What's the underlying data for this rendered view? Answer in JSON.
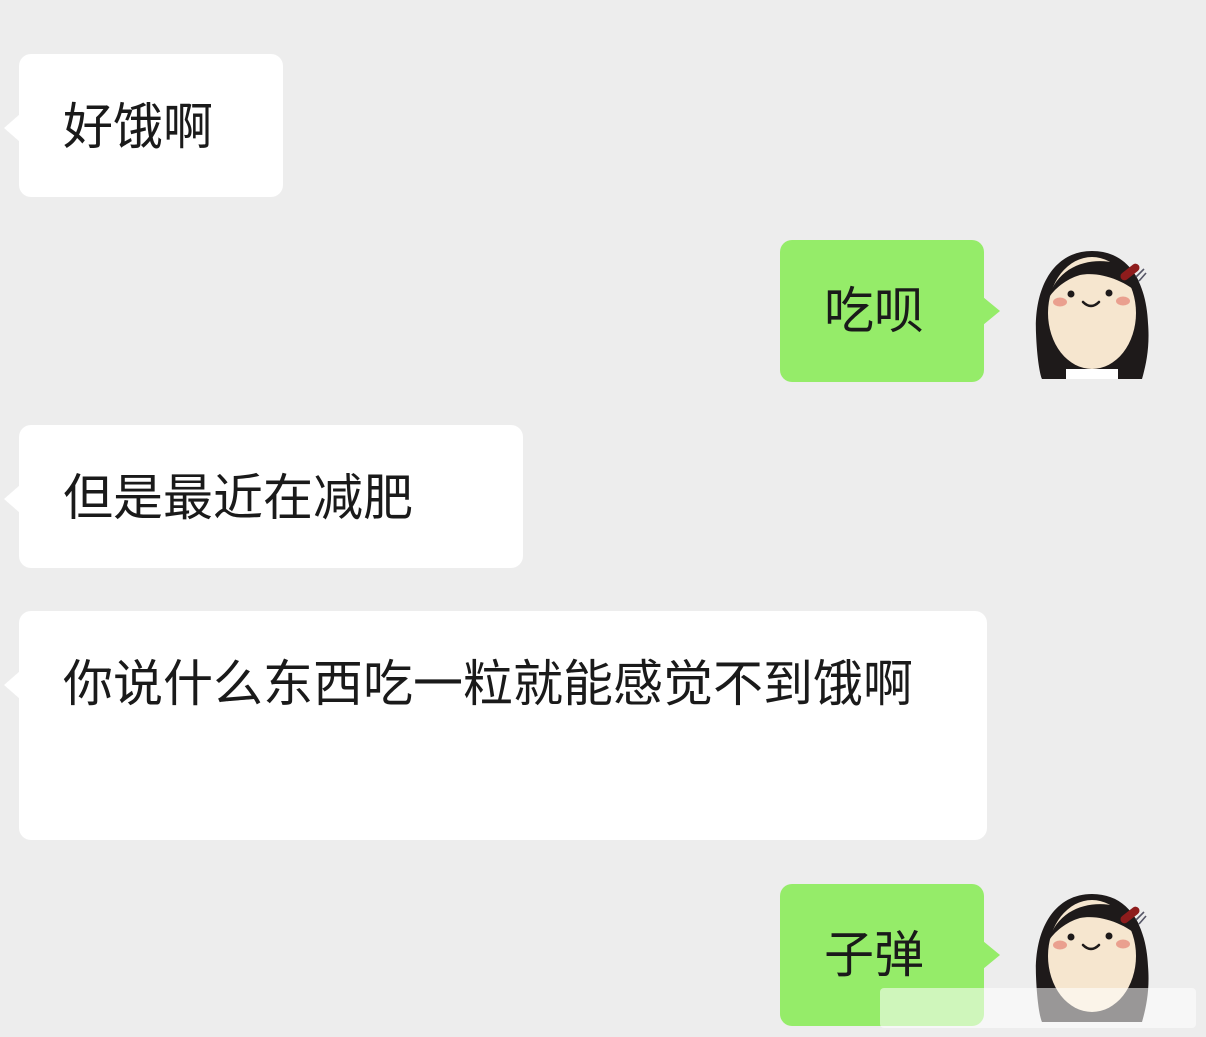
{
  "messages": [
    {
      "side": "left",
      "text": "好饿啊"
    },
    {
      "side": "right",
      "text": "吃呗"
    },
    {
      "side": "left",
      "text": "但是最近在减肥"
    },
    {
      "side": "left",
      "text": "你说什么东西吃一粒就能感觉不到饿啊"
    },
    {
      "side": "right",
      "text": "子弹"
    }
  ],
  "avatar": {
    "icon": "cartoon-girl-avatar-icon"
  },
  "colors": {
    "background": "#ededed",
    "incoming_bubble": "#ffffff",
    "outgoing_bubble": "#95ec69",
    "text": "#1a1a1a"
  }
}
